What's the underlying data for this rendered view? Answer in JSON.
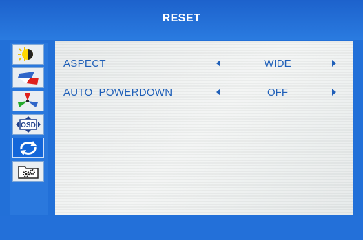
{
  "menu": {
    "title": "RESET"
  },
  "sidebar": {
    "items": [
      {
        "icon": "brightness-contrast-icon"
      },
      {
        "icon": "image-position-icon"
      },
      {
        "icon": "color-icon"
      },
      {
        "icon": "osd-icon",
        "text": "OSD"
      },
      {
        "icon": "reset-icon"
      },
      {
        "icon": "settings-folder-icon"
      }
    ]
  },
  "settings": [
    {
      "label": "ASPECT",
      "value": "WIDE"
    },
    {
      "label": "AUTO  POWERDOWN",
      "value": "OFF"
    }
  ],
  "colors": {
    "accent": "#2270d8",
    "text": "#1f5fb8",
    "panel": "#eef1f0"
  }
}
